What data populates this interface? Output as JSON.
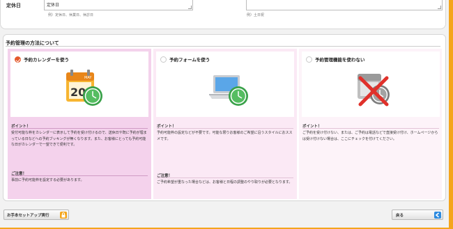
{
  "form": {
    "holiday_label": "定休日",
    "holiday_value": "定休日",
    "holiday_hint": "例）定休日、休業日、休診日",
    "right_hint": "例）土日祝"
  },
  "section": {
    "title": "予約管理の方法について"
  },
  "options": [
    {
      "label": "予約カレンダーを使う",
      "selected": true,
      "icon": "calendar-clock-icon",
      "point_title": "ポイント！",
      "point_text": "受付可能な枠をカレンダーに表示して予約を受け付けるので、送休日や既に予約が埋まっている日などへの予約ブッキングが無くなります。また、お客様にとっても予約可能な日がカレンダーで一望できて便利です。",
      "note_title": "ご注意！",
      "note_text": "事前に予約可能枠を設定する必要があります。"
    },
    {
      "label": "予約フォームを使う",
      "selected": false,
      "icon": "laptop-clock-icon",
      "point_title": "ポイント！",
      "point_text": "予約可能枠の設定などが不要です。可能な限りお客様のご希望に沿うスタイルにおススメです。",
      "note_title": "ご注意！",
      "note_text": "ご予約希望が重なった場合などは、お客様と日程の調整のやり取りが必要となります。"
    },
    {
      "label": "予約管理機能を使わない",
      "selected": false,
      "icon": "disabled-clock-icon",
      "point_title": "ポイント！",
      "point_text": "ご予約を受け付けない、または、ご予約は電話などで直接受け付け、ホームページからは受け付けない場合は、ここにチェックを付けてください。"
    }
  ],
  "footer": {
    "setup_label": "お手本セットアップ実行",
    "back_label": "戻る"
  },
  "colors": {
    "accent": "#f4a51c",
    "selected_radio": "#e45a2d",
    "col1_bg": "#f4d2ec",
    "col2_bg": "#fbe9f5",
    "col3_bg": "#fdf3f9"
  }
}
